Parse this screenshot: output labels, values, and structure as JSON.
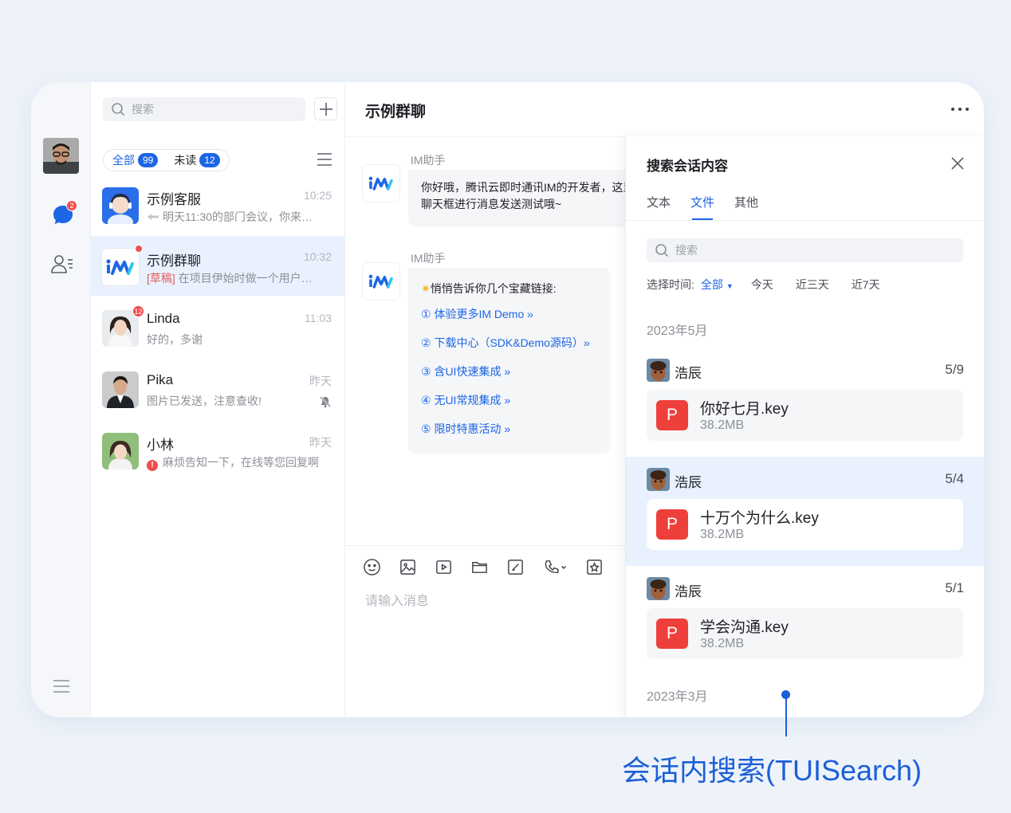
{
  "rail": {
    "chat_badge": "2"
  },
  "conversations": {
    "search_placeholder": "搜索",
    "filter": {
      "all_label": "全部",
      "all_count": "99",
      "unread_label": "未读",
      "unread_count": "12"
    },
    "items": [
      {
        "name": "示例客服",
        "time": "10:25",
        "preview": "明天11:30的部门会议，你来…",
        "icon": "reply-arrow-icon"
      },
      {
        "name": "示例群聊",
        "time": "10:32",
        "draft_tag": "[草稿]",
        "preview": "在项目伊始时做一个用户…"
      },
      {
        "name": "Linda",
        "time": "11:03",
        "preview": "好的，多谢",
        "badge": "12"
      },
      {
        "name": "Pika",
        "time": "昨天",
        "preview": "图片已发送，注意查收!"
      },
      {
        "name": "小林",
        "time": "昨天",
        "preview": "麻烦告知一下，在线等您回复啊"
      }
    ]
  },
  "chat": {
    "title": "示例群聊",
    "messages": [
      {
        "sender": "IM助手",
        "text": "你好哦，腾讯云即时通讯IM的开发者，这里是",
        "text2": "聊天框进行消息发送测试哦~"
      },
      {
        "sender": "IM助手",
        "text": "悄悄告诉你几个宝藏链接:",
        "links": [
          "① 体验更多IM Demo »",
          "② 下载中心（SDK&Demo源码）»",
          "③ 含UI快速集成 »",
          "④ 无UI常规集成 »",
          "⑤ 限时特惠活动 »"
        ]
      }
    ],
    "input_placeholder": "请输入消息"
  },
  "search_panel": {
    "title": "搜索会话内容",
    "tabs": [
      "文本",
      "文件",
      "其他"
    ],
    "active_tab": "文件",
    "search_placeholder": "搜索",
    "time_filter": {
      "label": "选择时间:",
      "options": [
        "全部",
        "今天",
        "近三天",
        "近7天"
      ],
      "active": "全部"
    },
    "months": [
      "2023年5月",
      "2023年3月"
    ],
    "files": [
      {
        "user": "浩辰",
        "date": "5/9",
        "icon_letter": "P",
        "name": "你好七月.key",
        "size": "38.2MB"
      },
      {
        "user": "浩辰",
        "date": "5/4",
        "icon_letter": "P",
        "name": "十万个为什么.key",
        "size": "38.2MB"
      },
      {
        "user": "浩辰",
        "date": "5/1",
        "icon_letter": "P",
        "name": "学会沟通.key",
        "size": "38.2MB"
      }
    ]
  },
  "callout": "会话内搜索(TUISearch)",
  "colors": {
    "accent": "#1c66e5",
    "badge": "#f04e4e",
    "file_icon": "#ef3f3b",
    "callout": "#1c5fd8"
  }
}
